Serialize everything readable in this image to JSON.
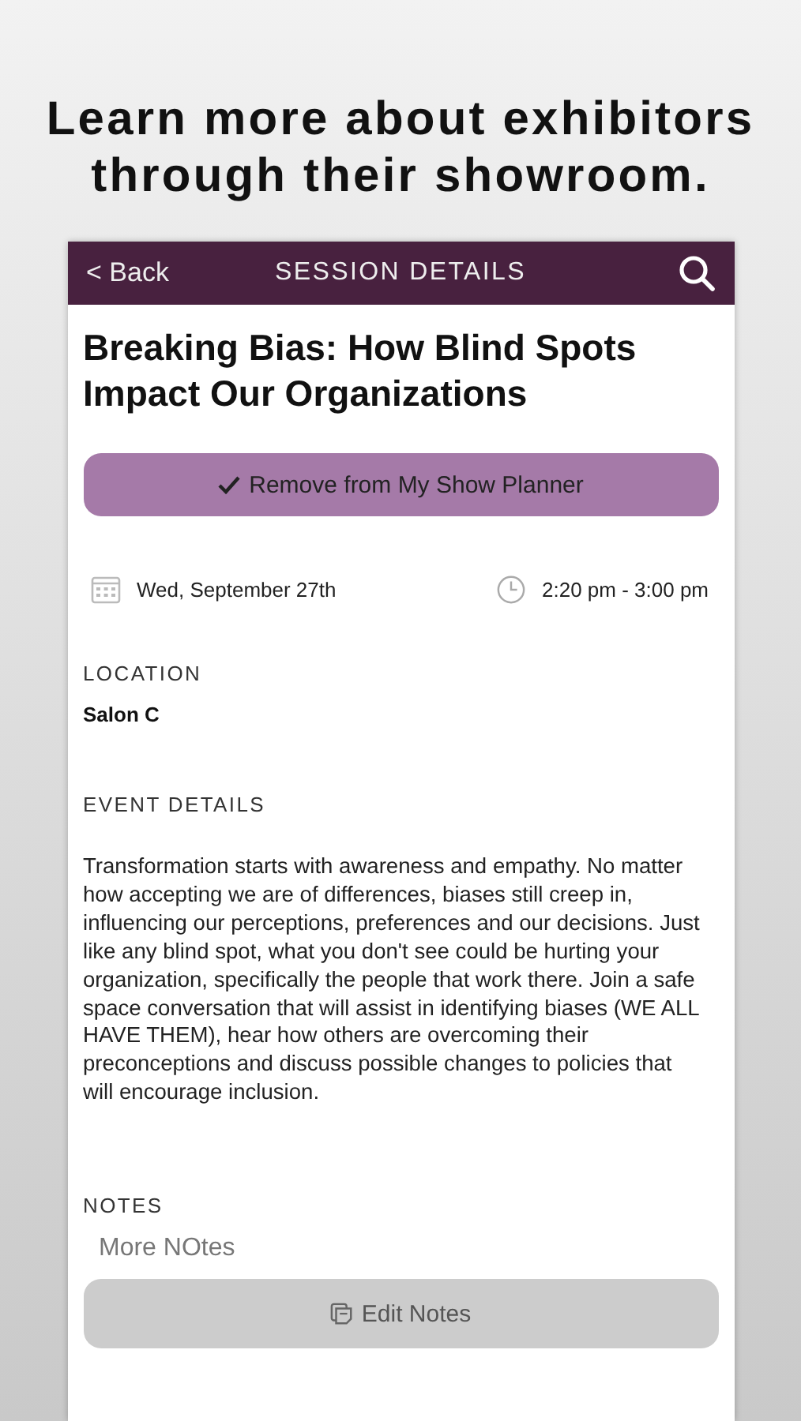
{
  "headline": "Learn more about exhibitors through their showroom.",
  "nav": {
    "back": "< Back",
    "title": "SESSION DETAILS"
  },
  "session": {
    "title": "Breaking Bias: How Blind Spots Impact Our Organizations",
    "planner_button": {
      "label": "Remove from My Show Planner",
      "checked": true
    },
    "date": "Wed, September 27th",
    "time": "2:20 pm - 3:00 pm"
  },
  "location": {
    "heading": "LOCATION",
    "value": "Salon C"
  },
  "event_details": {
    "heading": "EVENT DETAILS",
    "text": "Transformation starts with awareness and empathy. No matter how accepting we are of differences, biases still creep in, influencing our perceptions, preferences and our decisions. Just like any blind spot, what you don't see could be hurting your organization, specifically the people that work there. Join a safe space conversation that will assist in identifying biases (WE ALL HAVE THEM), hear how others are overcoming their preconceptions and discuss possible changes to policies that will encourage inclusion."
  },
  "notes": {
    "heading": "NOTES",
    "value": "More NOtes",
    "button": "Edit Notes"
  }
}
